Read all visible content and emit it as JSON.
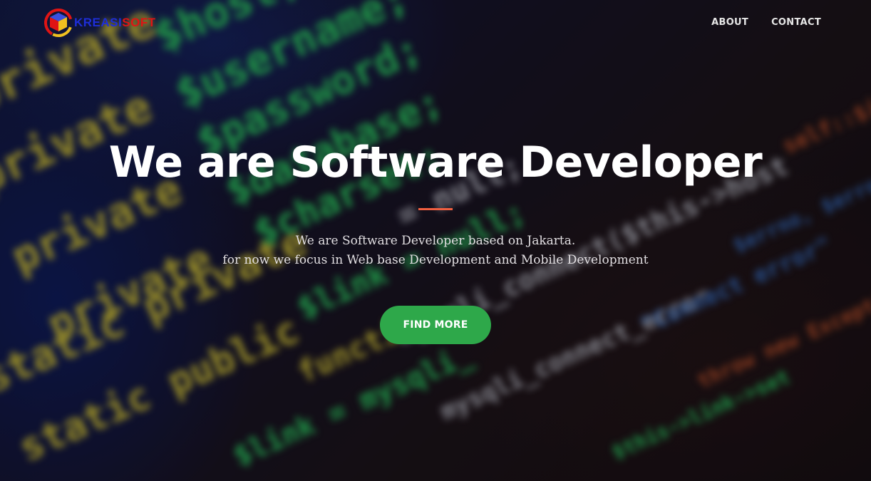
{
  "brand": {
    "name_part1": "KREASI",
    "name_part2": "SOFT",
    "colors": {
      "part1": "#1e2ed8",
      "part2": "#e01414"
    },
    "icon": "cube-logo-icon"
  },
  "nav": {
    "items": [
      {
        "label": "ABOUT"
      },
      {
        "label": "CONTACT"
      }
    ]
  },
  "hero": {
    "headline": "We are Software Developer",
    "subtitle_line1": "We are Software Developer based on Jakarta.",
    "subtitle_line2": "for now we focus in Web base Development and Mobile Development",
    "cta_label": "FIND MORE",
    "accent_color": "#f05f40",
    "cta_color": "#2ea84a"
  }
}
